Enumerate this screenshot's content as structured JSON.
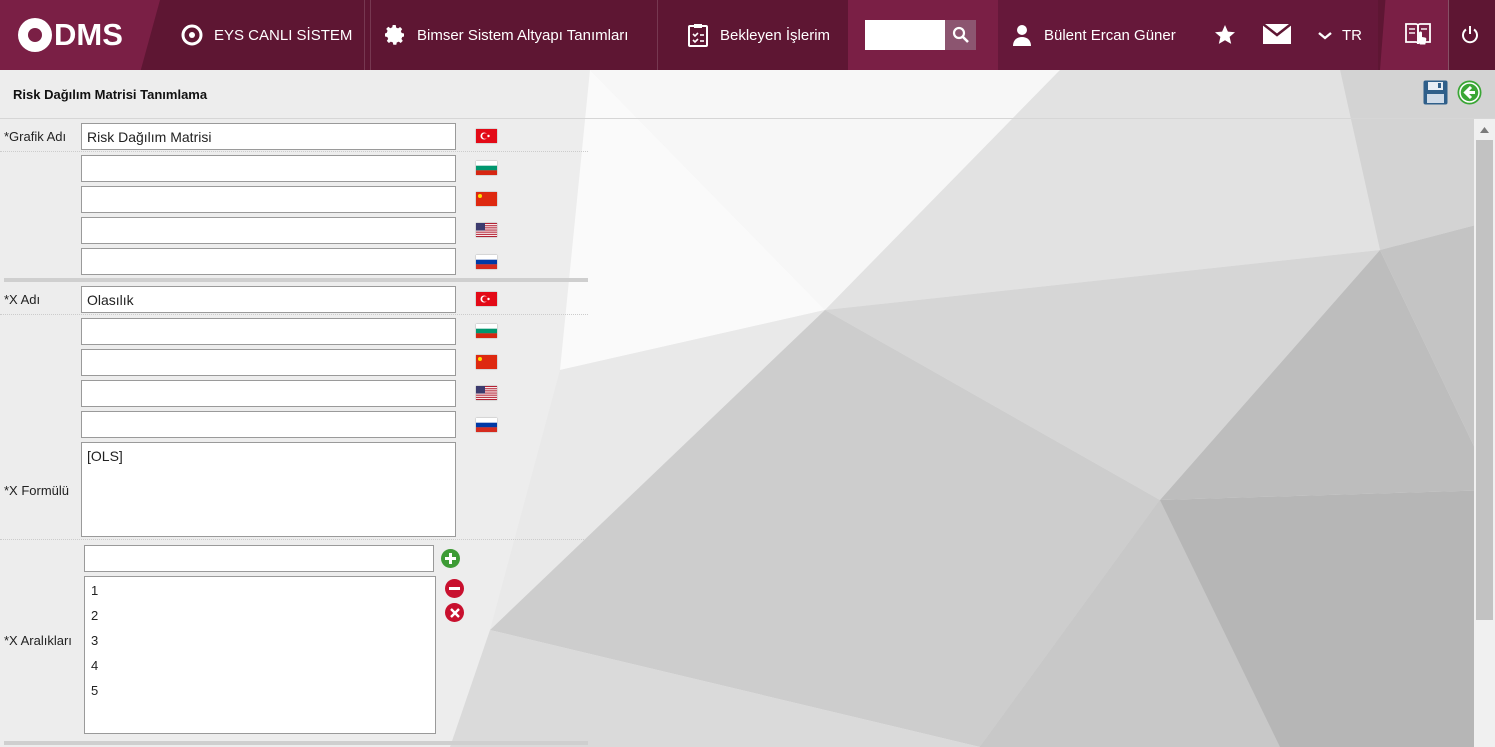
{
  "header": {
    "logo_text": "DMS",
    "nav": [
      {
        "label": "EYS CANLI SİSTEM",
        "icon": "q-logo-icon"
      },
      {
        "label": "Bimser Sistem Altyapı Tanımları",
        "icon": "gear-icon"
      },
      {
        "label": "Bekleyen İşlerim",
        "icon": "clipboard-icon"
      }
    ],
    "search": {
      "value": "",
      "placeholder": ""
    },
    "user_name": "Bülent Ercan Güner",
    "language": "TR"
  },
  "page": {
    "title": "Risk Dağılım Matrisi Tanımlama"
  },
  "form": {
    "grafik_adi": {
      "label": "*Grafik Adı",
      "values": [
        "Risk Dağılım Matrisi",
        "",
        "",
        "",
        ""
      ]
    },
    "x_adi": {
      "label": "*X Adı",
      "values": [
        "Olasılık",
        "",
        "",
        "",
        ""
      ]
    },
    "x_formulu": {
      "label": "*X Formülü",
      "value": "[OLS]"
    },
    "x_araliklari": {
      "label": "*X Aralıkları",
      "new_value": "",
      "items": [
        "1",
        "2",
        "3",
        "4",
        "5"
      ]
    }
  },
  "flags": [
    "turkey-flag-icon",
    "bulgaria-flag-icon",
    "china-flag-icon",
    "usa-flag-icon",
    "russia-flag-icon"
  ],
  "colors": {
    "header_bg": "#5e1633",
    "header_accent": "#7a1f45",
    "add_green": "#3d9b35",
    "remove_red": "#c8102e",
    "back_green": "#3aa635",
    "save_blue": "#2f5f8a"
  }
}
